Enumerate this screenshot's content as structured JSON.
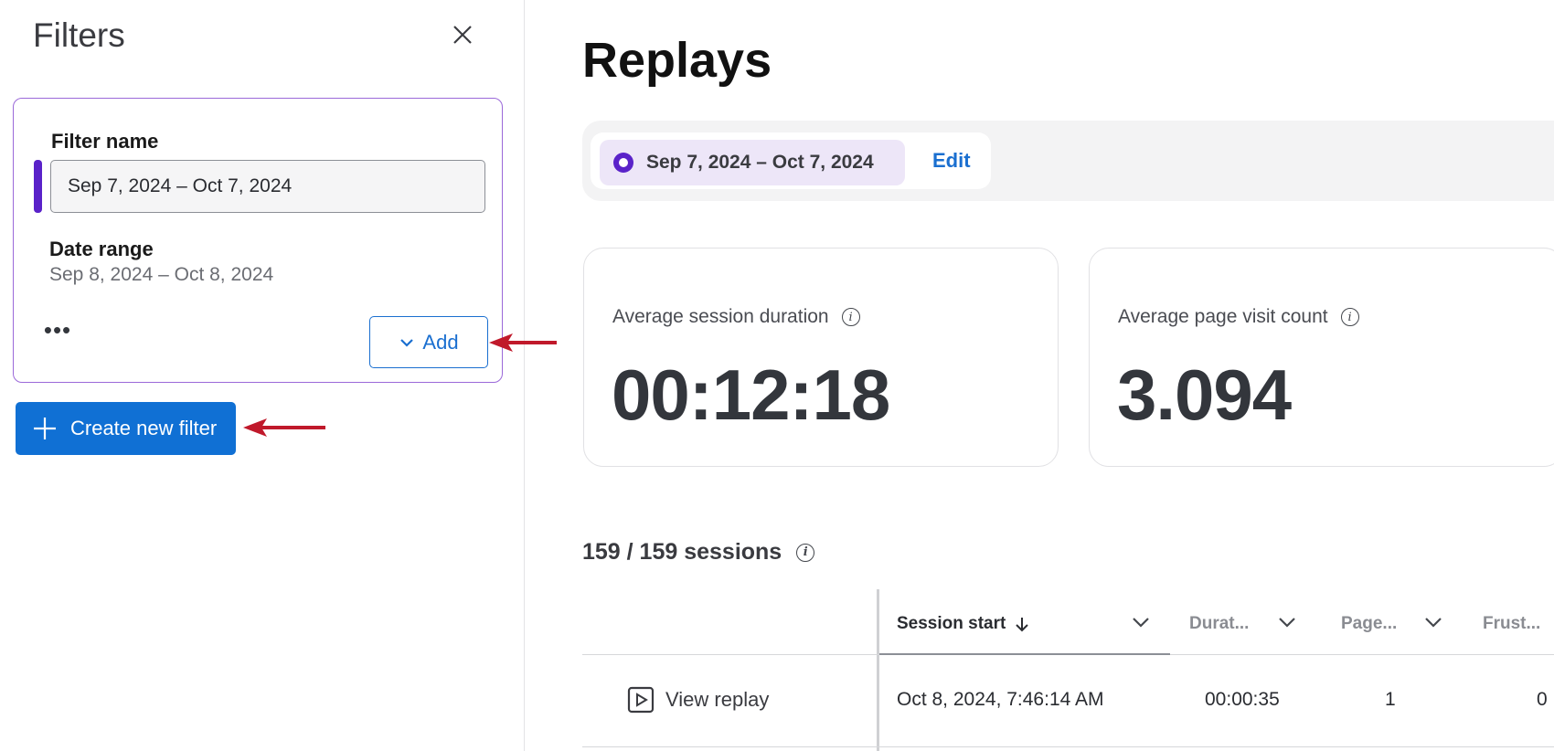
{
  "filters_panel": {
    "title": "Filters",
    "filter": {
      "name_label": "Filter name",
      "name_value": "Sep 7, 2024 – Oct 7, 2024",
      "date_range_label": "Date range",
      "date_range_value": "Sep 8, 2024 – Oct 8, 2024",
      "more_label": "•••",
      "add_label": "Add"
    },
    "create_label": "Create new filter"
  },
  "main": {
    "title": "Replays",
    "date_chip": "Sep 7, 2024 – Oct 7, 2024",
    "edit_label": "Edit",
    "metrics": [
      {
        "label": "Average session duration",
        "value": "00:12:18"
      },
      {
        "label": "Average page visit count",
        "value": "3.094"
      }
    ],
    "sessions_count": "159 / 159 sessions",
    "table": {
      "columns": [
        "Session start",
        "Durat...",
        "Page...",
        "Frust..."
      ],
      "rows": [
        {
          "action": "View replay",
          "session_start": "Oct 8, 2024, 7:46:14 AM",
          "duration": "00:00:35",
          "pages": "1",
          "frustration": "0"
        }
      ]
    }
  },
  "colors": {
    "accent_purple": "#5a22c9",
    "primary_blue": "#1070d4",
    "annotation_red": "#c0192b"
  }
}
